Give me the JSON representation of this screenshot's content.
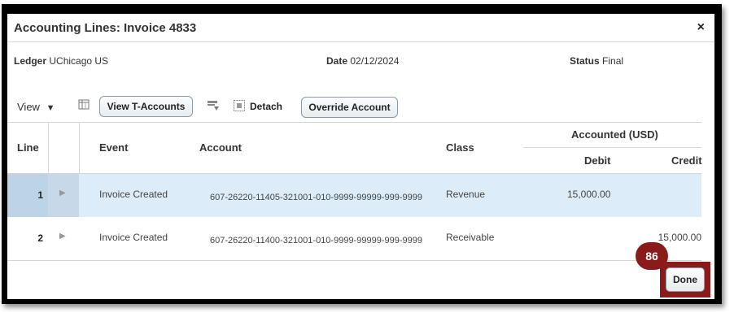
{
  "dialog": {
    "title": "Accounting Lines: Invoice 4833",
    "close_glyph": "×"
  },
  "meta": {
    "ledger_label": "Ledger",
    "ledger_value": "UChicago US",
    "date_label": "Date",
    "date_value": "02/12/2024",
    "status_label": "Status",
    "status_value": "Final"
  },
  "toolbar": {
    "view_label": "View",
    "view_t_accounts_label": "View T-Accounts",
    "detach_label": "Detach",
    "override_account_label": "Override Account"
  },
  "table": {
    "headers": {
      "line": "Line",
      "event": "Event",
      "account": "Account",
      "class": "Class",
      "accounted_group": "Accounted (USD)",
      "debit": "Debit",
      "credit": "Credit"
    },
    "rows": [
      {
        "line": "1",
        "event": "Invoice Created",
        "account": "607-26220-11405-321001-010-9999-99999-999-9999",
        "class": "Revenue",
        "debit": "15,000.00",
        "credit": ""
      },
      {
        "line": "2",
        "event": "Invoice Created",
        "account": "607-26220-11400-321001-010-9999-99999-999-9999",
        "class": "Receivable",
        "debit": "",
        "credit": "15,000.00"
      }
    ]
  },
  "overlay": {
    "step_badge": "86"
  },
  "footer": {
    "done_label": "Done"
  },
  "icons": [
    "close-icon",
    "view-dropdown-icon",
    "freeze-columns-icon",
    "query-by-example-icon",
    "detach-icon",
    "disclosure-icon"
  ],
  "colors": {
    "selected_row": "#dcecf8",
    "selected_line_cell": "#bdd4e6",
    "highlight_frame": "#8b1a1a"
  }
}
